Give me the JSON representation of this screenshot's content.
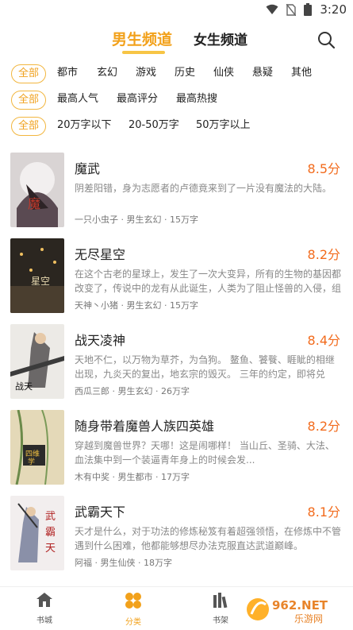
{
  "status_bar": {
    "time": "3:20"
  },
  "header": {
    "tabs": [
      {
        "label": "男生频道",
        "active": true
      },
      {
        "label": "女生频道",
        "active": false
      }
    ],
    "search_icon": "search-icon"
  },
  "filters": {
    "row1": [
      "全部",
      "都市",
      "玄幻",
      "游戏",
      "历史",
      "仙侠",
      "悬疑",
      "其他"
    ],
    "row2": [
      "全部",
      "最高人气",
      "最高评分",
      "最高热搜"
    ],
    "row3": [
      "全部",
      "20万字以下",
      "20-50万字",
      "50万字以上"
    ]
  },
  "books": [
    {
      "title": "魔武",
      "score": "8.5分",
      "desc": "阴差阳错，身为志愿者的卢德竟来到了一片没有魔法的大陆。",
      "meta": "一只小虫子 · 男生玄幻 · 15万字"
    },
    {
      "title": "无尽星空",
      "score": "8.2分",
      "desc": "在这个古老的星球上，发生了一次大变异，所有的生物的基因都改变了，传说中的龙有从此诞生，人类为了阻止怪兽的入侵，组成了联...",
      "meta": "天神丶小猪 · 男生玄幻 · 15万字"
    },
    {
      "title": "战天凌神",
      "score": "8.4分",
      "desc": "天地不仁，以万物为草芥，为刍狗。 鳌鱼、饕餮、睚眦的相继出现，九炎天的复出，地玄宗的毁灭。 三年的约定，即将兑现。 天玄、蛮...",
      "meta": "西瓜三郎 · 男生玄幻 · 26万字"
    },
    {
      "title": "随身带着魔兽人族四英雄",
      "score": "8.2分",
      "desc": "穿越到魔兽世界？天哪！这是闹哪样！ 当山丘、圣骑、大法、血法集中到一个装逼青年身上的时候会发...",
      "meta": "木有中奖 · 男生都市 · 17万字"
    },
    {
      "title": "武霸天下",
      "score": "8.1分",
      "desc": "天才是什么，对于功法的修炼秘笈有着超强领悟，在修炼中不管遇到什么困难，他都能够想尽办法克服直达武道巅峰。",
      "meta": "阿福 · 男生仙侠 · 18万字"
    }
  ],
  "bottom_nav": [
    {
      "label": "书城",
      "icon": "home-icon",
      "active": false
    },
    {
      "label": "分类",
      "icon": "category-icon",
      "active": true
    },
    {
      "label": "书架",
      "icon": "bookshelf-icon",
      "active": false
    }
  ],
  "watermark": {
    "text": "962.NET",
    "sub": "乐游网"
  },
  "colors": {
    "accent": "#f2a11b",
    "score": "#f26b1d",
    "chip_border": "#f2b63f"
  }
}
